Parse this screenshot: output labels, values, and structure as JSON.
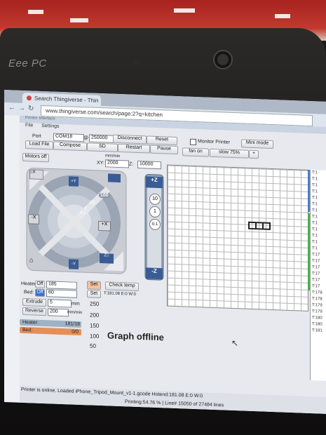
{
  "browser": {
    "tab_title": "Search Thingiverse - Thin",
    "url": "www.thingiverse.com/search/page:2?q=kitchen"
  },
  "laptop": {
    "brand": "Eee PC"
  },
  "app": {
    "title": "Printer Interface",
    "menu": [
      "File",
      "Settings"
    ],
    "toolbar": {
      "port_label": "Port",
      "port_value": "COM18",
      "at": "@",
      "baud_value": "250000",
      "disconnect": "Disconnect",
      "reset": "Reset",
      "monitor": "Monitor Printer",
      "mini_mode": "Mini mode",
      "load_file": "Load File",
      "compose": "Compose",
      "sd": "SD",
      "restart": "Restart",
      "pause": "Pause",
      "fan_on": "fan on",
      "slow": "slow 75%",
      "plus": "+"
    },
    "jog": {
      "motors_off": "Motors off",
      "mm_min": "mm/min",
      "xy_label": "XY:",
      "xy_value": "2000",
      "z_label": "Z:",
      "z_value": "10000",
      "minus_y": "-Y",
      "plus_y": "+Y",
      "minus_x": "-X",
      "plus_x": "+X",
      "plus_z": "+Z",
      "minus_z": "-Z",
      "steps": [
        "100",
        "10",
        "1",
        "0.1"
      ],
      "z_steps": [
        "10",
        "1",
        "0.1"
      ]
    },
    "temps": {
      "heater_label": "Heater:",
      "heater_off": "Off",
      "heater_value": "185",
      "bed_label": "Bed:",
      "bed_off": "Off",
      "bed_value": "60",
      "extrude": "Extrude",
      "extrude_value": "5",
      "extrude_unit": "mm",
      "reverse": "Reverse",
      "reverse_value": "200",
      "reverse_unit": "mm/min",
      "set": "Set",
      "check_temp": "Check temp",
      "temp_readout": "T:181.08 E:0 W:0",
      "heater_bar": "Heater:",
      "heater_bar_val": "181/18",
      "bed_bar": "Bed:",
      "bed_bar_val": "0/0"
    },
    "graph": {
      "title": "Graph offline",
      "ticks": [
        "250",
        "200",
        "150",
        "100",
        "50"
      ]
    },
    "log_lines": [
      "T:1",
      "T:1",
      "T:1",
      "T:1",
      "T:1",
      "T:1",
      "T:1",
      "T:1",
      "T:1",
      "T:1",
      "T:1",
      "T:1",
      "T:1",
      "T:17",
      "T:17",
      "T:17",
      "T:17",
      "T:17",
      "T:17",
      "T:178",
      "T:178",
      "T:179",
      "T:179",
      "T:180",
      "T:180",
      "T:181"
    ],
    "status": {
      "line1": "Printer is online. Loaded iPhone_Tripod_Mount_v1-1.gcode Hotend:181.08 E:0 W:0",
      "line2": "Printing:54.76 % | Line# 15050 of 27484 lines"
    },
    "colors": {
      "heater_bar": "#9fb2c6",
      "bed_bar": "#e48f5a",
      "log_green": "#43b643",
      "log_blue": "#4a7ed0"
    }
  }
}
